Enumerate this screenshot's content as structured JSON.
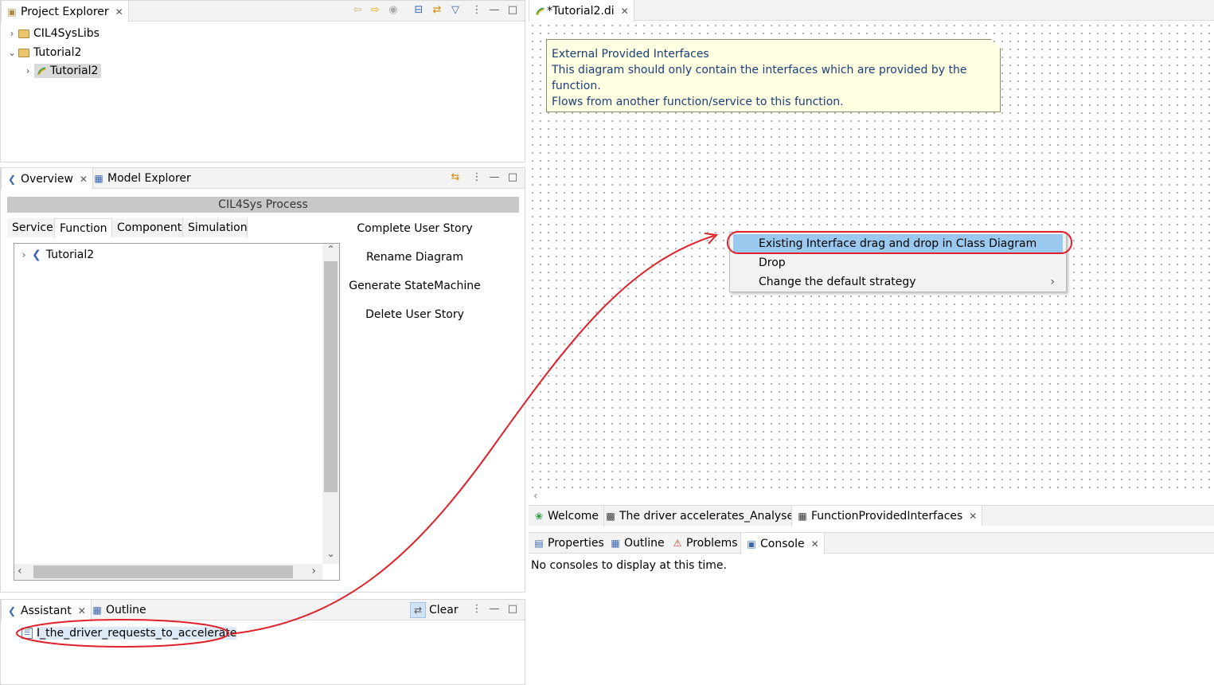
{
  "project_explorer": {
    "title": "Project Explorer",
    "items": [
      {
        "label": "CIL4SysLibs",
        "expanded": false
      },
      {
        "label": "Tutorial2",
        "expanded": true
      },
      {
        "label": "Tutorial2",
        "selected": true
      }
    ]
  },
  "middle_left": {
    "tabs": [
      {
        "label": "Overview"
      },
      {
        "label": "Model Explorer"
      }
    ],
    "process_title": "CIL4Sys Process",
    "subtabs": [
      "Service",
      "Function",
      "Component",
      "Simulation"
    ],
    "active_subtab": "Function",
    "tree_item": "Tutorial2",
    "actions": [
      "Complete User Story",
      "Rename Diagram",
      "Generate StateMachine",
      "Delete User Story"
    ]
  },
  "assistant": {
    "tabs": [
      {
        "label": "Assistant"
      },
      {
        "label": "Outline"
      }
    ],
    "clear_label": "Clear",
    "item": "I_the_driver_requests_to_accelerate"
  },
  "editor": {
    "tab_label": "*Tutorial2.di",
    "note": {
      "title": "External Provided Interfaces",
      "line1": "This diagram should only contain the interfaces which are provided by the function.",
      "line2": "Flows from another function/service to this function."
    },
    "menu": {
      "items": [
        "Existing Interface drag and drop in Class Diagram",
        "Drop",
        "Change the default strategy"
      ],
      "highlighted_index": 0
    },
    "bottom_tabs": [
      "Welcome",
      "The driver accelerates_Analysed",
      "FunctionProvidedInterfaces"
    ]
  },
  "console_panel": {
    "tabs": [
      "Properties",
      "Outline",
      "Problems",
      "Console"
    ],
    "message": "No consoles to display at this time."
  },
  "colors": {
    "highlight": "#99c9ef",
    "annotation_red": "#e0202a",
    "note_bg": "#ffffe1"
  }
}
